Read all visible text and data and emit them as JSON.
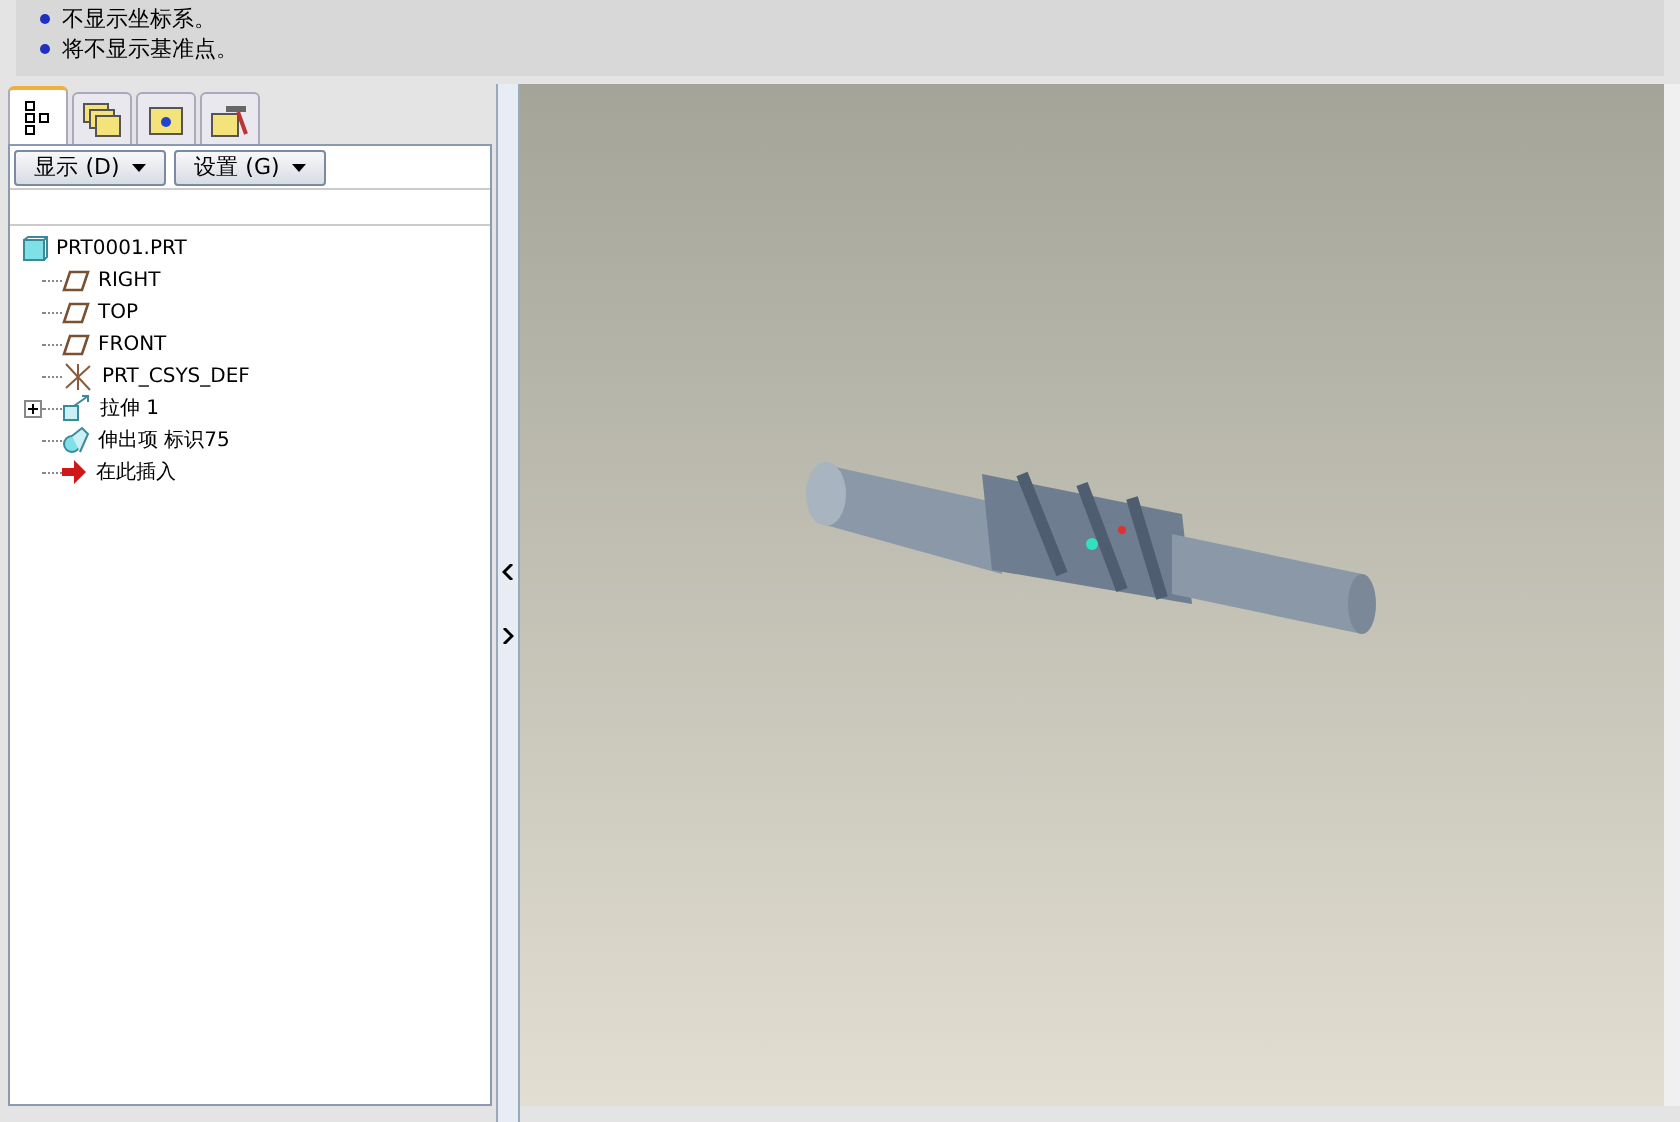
{
  "messages": [
    "不显示坐标系。",
    "将不显示基准点。"
  ],
  "panel_tabs": [
    {
      "kind": "tree",
      "selected": true
    },
    {
      "kind": "layers",
      "selected": false
    },
    {
      "kind": "favorites",
      "selected": false
    },
    {
      "kind": "tools",
      "selected": false
    }
  ],
  "panel_buttons": [
    "显示 (D)",
    "设置 (G)"
  ],
  "model_tree": {
    "label": "PRT0001.PRT",
    "kind": "part",
    "children": [
      {
        "label": "RIGHT",
        "kind": "plane"
      },
      {
        "label": "TOP",
        "kind": "plane"
      },
      {
        "label": "FRONT",
        "kind": "plane"
      },
      {
        "label": "PRT_CSYS_DEF",
        "kind": "csys"
      },
      {
        "label": "拉伸 1",
        "kind": "extrude",
        "expanded": false
      },
      {
        "label": "伸出项 标识75",
        "kind": "protrusion"
      },
      {
        "label": "在此插入",
        "kind": "insert"
      }
    ]
  }
}
